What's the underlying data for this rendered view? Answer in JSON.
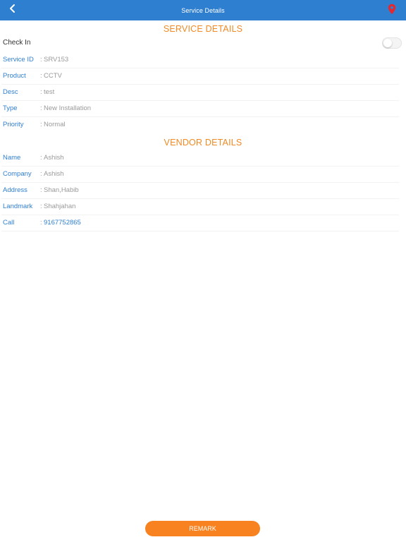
{
  "header": {
    "title": "Service Details",
    "back_icon": "chevron-left-icon",
    "location_icon": "map-pin-icon",
    "bar_color": "#2f7fd0",
    "pin_color": "#e8262d"
  },
  "service_section": {
    "title": "SERVICE DETAILS",
    "check_in": {
      "label": "Check In",
      "enabled": false
    },
    "fields": [
      {
        "label": "Service ID",
        "sep": ":",
        "value": "SRV153"
      },
      {
        "label": "Product",
        "sep": ":",
        "value": "CCTV"
      },
      {
        "label": "Desc",
        "sep": ":",
        "value": "test"
      },
      {
        "label": "Type",
        "sep": ":",
        "value": "New Installation"
      },
      {
        "label": "Priority",
        "sep": ":",
        "value": "Normal"
      }
    ]
  },
  "vendor_section": {
    "title": "VENDOR DETAILS",
    "fields": [
      {
        "label": "Name",
        "sep": ":",
        "value": "Ashish"
      },
      {
        "label": "Company",
        "sep": ":",
        "value": "Ashish"
      },
      {
        "label": "Address",
        "sep": ":",
        "value": "Shan,Habib"
      },
      {
        "label": "Landmark",
        "sep": ":",
        "value": "Shahjahan"
      },
      {
        "label": "Call",
        "sep": ":",
        "value": "9167752865"
      }
    ]
  },
  "footer": {
    "remark_label": "REMARK",
    "accent_color": "#f7821f"
  }
}
